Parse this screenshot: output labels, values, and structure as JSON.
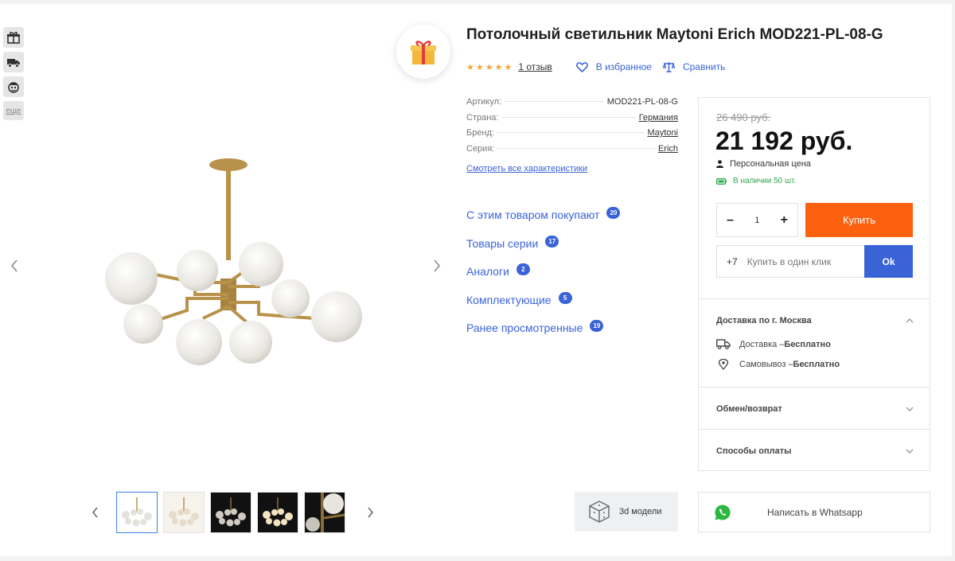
{
  "badges": [
    {
      "icon": "gift-icon"
    },
    {
      "icon": "delivery-truck-icon"
    },
    {
      "icon": "character-icon"
    }
  ],
  "badges_more_label": "еще",
  "product": {
    "title": "Потолочный светильник Maytoni Erich MOD221-PL-08-G",
    "rating_stars": "★★★★★",
    "reviews_label": "1 отзыв",
    "favorite_label": "В избранное",
    "compare_label": "Сравнить"
  },
  "specs": [
    {
      "label": "Артикул:",
      "value": "MOD221-PL-08-G",
      "link": false
    },
    {
      "label": "Страна:",
      "value": "Германия",
      "link": true
    },
    {
      "label": "Бренд:",
      "value": "Maytoni",
      "link": true
    },
    {
      "label": "Серия:",
      "value": "Erich",
      "link": true
    }
  ],
  "all_specs_label": "Смотреть все характеристики",
  "related": [
    {
      "label": "С этим товаром покупают",
      "count": "20"
    },
    {
      "label": "Товары серии",
      "count": "17"
    },
    {
      "label": "Аналоги",
      "count": "2"
    },
    {
      "label": "Комплектующие",
      "count": "5"
    },
    {
      "label": "Ранее просмотренные",
      "count": "19"
    }
  ],
  "price_card": {
    "old_price": "26 490 руб.",
    "price": "21 192 руб.",
    "personal_label": "Персональная цена",
    "stock_label": "В наличии 50 шт.",
    "qty_minus": "–",
    "qty_value": "1",
    "qty_plus": "+",
    "buy_label": "Купить",
    "oneclick_code": "+7",
    "oneclick_placeholder": "Купить в один клик",
    "ok_label": "Ok",
    "delivery_title": "Доставка по г. Москва",
    "delivery_prefix": "Доставка – ",
    "delivery_value": "Бесплатно",
    "pickup_prefix": "Самовывоз – ",
    "pickup_value": "Бесплатно",
    "exchange_title": "Обмен/возврат",
    "payment_title": "Способы оплаты"
  },
  "models_3d_label": "3d модели",
  "whatsapp_label": "Написать в Whatsapp",
  "colors": {
    "accent_blue": "#3a63d8",
    "buy_orange": "#fc6110",
    "stock_green": "#2aa84a",
    "stars": "#f7a233",
    "brass": "#b8924a"
  }
}
